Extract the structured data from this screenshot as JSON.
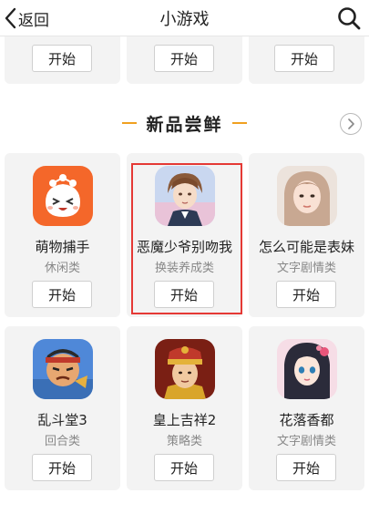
{
  "header": {
    "back_label": "返回",
    "title": "小游戏"
  },
  "top_row": {
    "buttons": [
      "开始",
      "开始",
      "开始"
    ]
  },
  "section": {
    "title": "新品尝鲜"
  },
  "games": [
    {
      "name": "萌物捕手",
      "category": "休闲类",
      "button": "开始"
    },
    {
      "name": "恶魔少爷别吻我",
      "category": "换装养成类",
      "button": "开始"
    },
    {
      "name": "怎么可能是表妹",
      "category": "文字剧情类",
      "button": "开始"
    },
    {
      "name": "乱斗堂3",
      "category": "回合类",
      "button": "开始"
    },
    {
      "name": "皇上吉祥2",
      "category": "策略类",
      "button": "开始"
    },
    {
      "name": "花落香都",
      "category": "文字剧情类",
      "button": "开始"
    }
  ],
  "colors": {
    "accent_dash": "#f0a020",
    "highlight": "#e53935",
    "card_bg": "#f3f3f3"
  }
}
